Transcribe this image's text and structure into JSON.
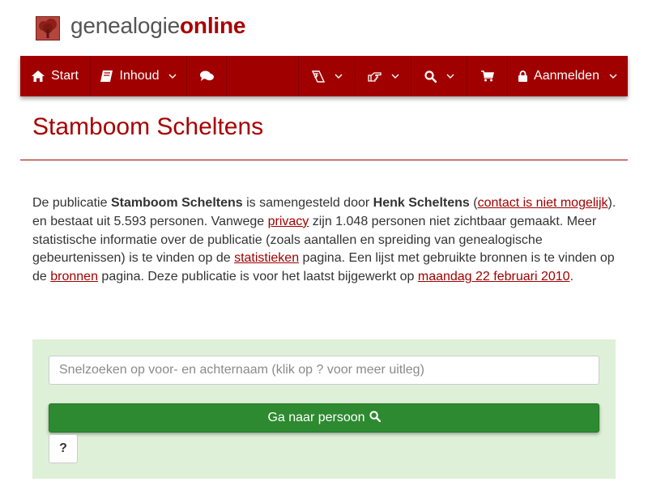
{
  "header": {
    "logo_text_light": "genealogie",
    "logo_text_bold": "online",
    "brand_color": "#a10000"
  },
  "nav": {
    "start_label": "Start",
    "inhoud_label": "Inhoud",
    "login_label": "Aanmelden",
    "icons": [
      "home-icon",
      "book-icon",
      "comments-icon",
      "language-icon",
      "hand-pointer-icon",
      "search-icon",
      "cart-icon",
      "lock-icon"
    ]
  },
  "page": {
    "title": "Stamboom Scheltens"
  },
  "intro": {
    "t1": "De publicatie ",
    "pub_name": "Stamboom Scheltens",
    "t2": " is samengesteld door ",
    "author": "Henk Scheltens",
    "t3": " (",
    "contact_link": "contact is niet mogelijk",
    "t4": "). en bestaat uit 5.593 personen. Vanwege ",
    "privacy_link": "privacy",
    "t5": " zijn 1.048 personen niet zichtbaar gemaakt. Meer statistische informatie over de publicatie (zoals aantallen en spreiding van genealogische gebeurtenissen) is te vinden op de ",
    "stats_link": "statistieken",
    "t6": " pagina. Een lijst met gebruikte bronnen is te vinden op de ",
    "sources_link": "bronnen",
    "t7": " pagina. Deze publicatie is voor het laatst bijgewerkt op ",
    "date_link": "maandag 22 februari 2010",
    "t8": "."
  },
  "search": {
    "placeholder": "Snelzoeken op voor- en achternaam (klik op ? voor meer uitleg)",
    "value": "",
    "go_label": "Ga naar persoon",
    "help_label": "?",
    "panel_color": "#dff0d8",
    "button_color": "#2d8a30"
  }
}
